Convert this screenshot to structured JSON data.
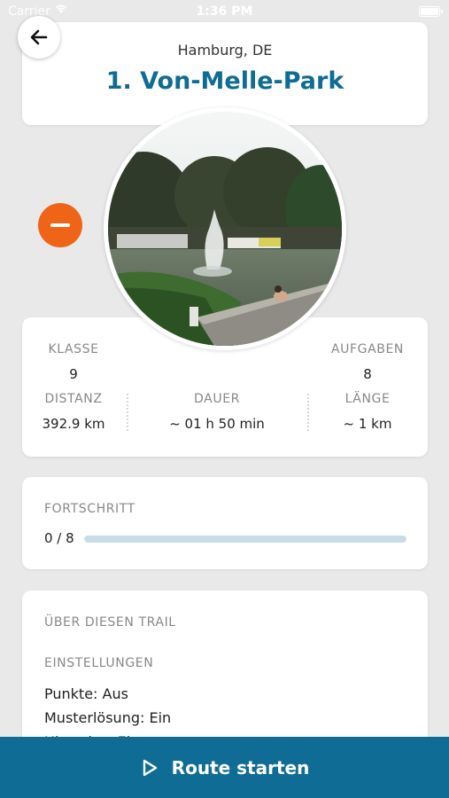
{
  "status_bar": {
    "carrier": "Carrier",
    "time": "1:36 PM"
  },
  "header": {
    "city": "Hamburg, DE",
    "title": "1. Von-Melle-Park"
  },
  "icons": {
    "back": "arrow-left-icon",
    "remove": "minus-icon",
    "play": "play-icon",
    "wifi": "wifi-icon",
    "battery": "battery-icon"
  },
  "stats": {
    "klasse_label": "KLASSE",
    "klasse_value": "9",
    "aufgaben_label": "AUFGABEN",
    "aufgaben_value": "8",
    "distanz_label": "DISTANZ",
    "distanz_value": "392.9 km",
    "dauer_label": "DAUER",
    "dauer_value": "~ 01 h 50 min",
    "laenge_label": "LÄNGE",
    "laenge_value": "~ 1 km"
  },
  "progress": {
    "label": "FORTSCHRITT",
    "count": "0 / 8",
    "done": 0,
    "total": 8
  },
  "about": {
    "title": "ÜBER DIESEN TRAIL",
    "settings_label": "EINSTELLUNGEN",
    "settings": [
      "Punkte: Aus",
      "Musterlösung: Ein",
      "Hinweise: Ein"
    ]
  },
  "start_button": {
    "label": "Route starten"
  },
  "colors": {
    "accent": "#0f6c95",
    "remove": "#f06418",
    "background": "#e9e9e9",
    "progress_track": "#c9dde8"
  }
}
